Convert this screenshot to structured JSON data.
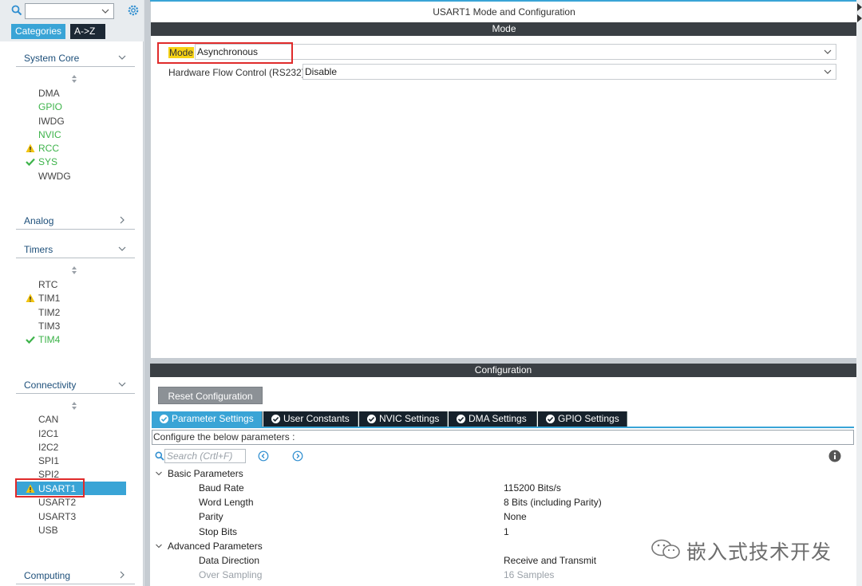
{
  "sidebar": {
    "tabs": {
      "categories": "Categories",
      "az": "A->Z"
    },
    "sections": {
      "system_core": "System Core",
      "analog": "Analog",
      "timers": "Timers",
      "connectivity": "Connectivity",
      "computing": "Computing"
    },
    "system_core_items": [
      "DMA",
      "GPIO",
      "IWDG",
      "NVIC",
      "RCC",
      "SYS",
      "WWDG"
    ],
    "timers_items": [
      "RTC",
      "TIM1",
      "TIM2",
      "TIM3",
      "TIM4"
    ],
    "connectivity_items": [
      "CAN",
      "I2C1",
      "I2C2",
      "SPI1",
      "SPI2",
      "USART1",
      "USART2",
      "USART3",
      "USB"
    ]
  },
  "mode_panel": {
    "title": "USART1 Mode and Configuration",
    "bar": "Mode",
    "mode_label": "Mode",
    "mode_value": "Asynchronous",
    "flow_label": "Hardware Flow Control (RS232)",
    "flow_value": "Disable"
  },
  "config_panel": {
    "bar": "Configuration",
    "reset_button": "Reset Configuration",
    "tabs": [
      "Parameter Settings",
      "User Constants",
      "NVIC Settings",
      "DMA Settings",
      "GPIO Settings"
    ],
    "description": "Configure the below parameters :",
    "search_placeholder": "Search (Crtl+F)",
    "groups": {
      "basic": "Basic Parameters",
      "advanced": "Advanced Parameters"
    },
    "basic_params": [
      {
        "name": "Baud Rate",
        "value": "115200 Bits/s"
      },
      {
        "name": "Word Length",
        "value": "8 Bits (including Parity)"
      },
      {
        "name": "Parity",
        "value": "None"
      },
      {
        "name": "Stop Bits",
        "value": "1"
      }
    ],
    "advanced_params": [
      {
        "name": "Data Direction",
        "value": "Receive and Transmit"
      },
      {
        "name": "Over Sampling",
        "value": "16 Samples"
      }
    ]
  },
  "watermark": "嵌入式技术开发",
  "colors": {
    "accent": "#39a4d6",
    "enabled_green": "#3db34a",
    "warning_yellow": "#f2c40f",
    "highlight_box": "#e02b2b",
    "dark_tab": "#16212b"
  }
}
